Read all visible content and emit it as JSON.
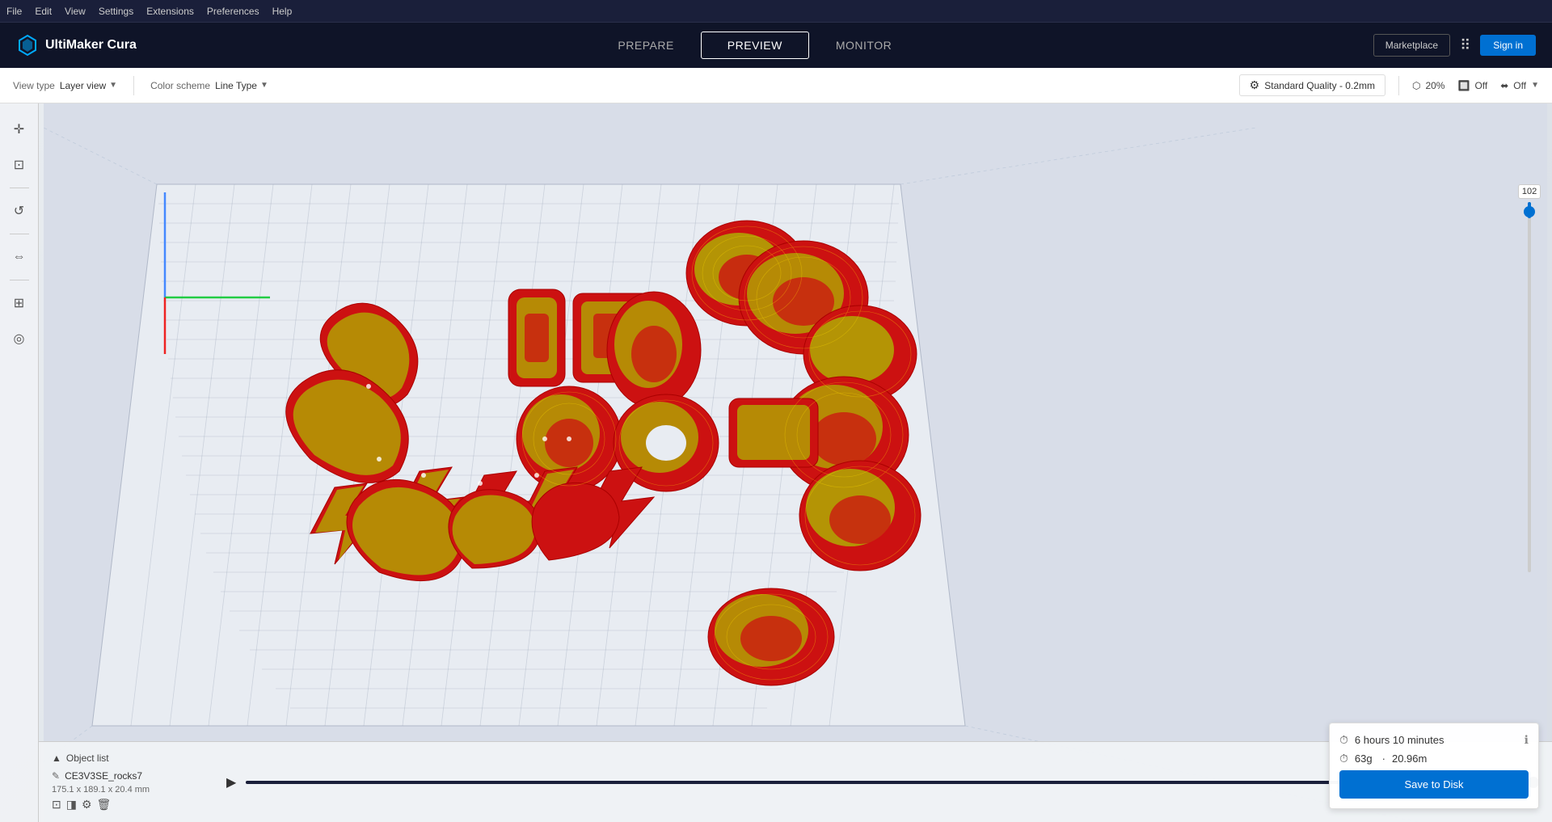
{
  "app": {
    "title": "UltiMaker Cura",
    "logo_symbol": "⬡"
  },
  "menu": {
    "items": [
      "File",
      "Edit",
      "View",
      "Settings",
      "Extensions",
      "Preferences",
      "Help"
    ]
  },
  "nav": {
    "tabs": [
      "PREPARE",
      "PREVIEW",
      "MONITOR"
    ],
    "active": "PREVIEW"
  },
  "header_right": {
    "marketplace": "Marketplace",
    "signin": "Sign in"
  },
  "toolbar": {
    "view_type_label": "View type",
    "view_type_value": "Layer view",
    "color_scheme_label": "Color scheme",
    "color_scheme_value": "Line Type",
    "quality_label": "Standard Quality - 0.2mm",
    "infill_label": "20%",
    "support_label": "Off",
    "adhesion_label": "Off"
  },
  "layer_slider": {
    "value": "102"
  },
  "object_list": {
    "header": "Object list",
    "items": [
      {
        "name": "CE3V3SE_rocks7",
        "dimensions": "175.1 x 189.1 x 20.4 mm"
      }
    ]
  },
  "print_info": {
    "time": "6 hours 10 minutes",
    "weight": "63g",
    "length": "20.96m",
    "save_label": "Save to Disk"
  },
  "playback": {
    "play_icon": "▶"
  },
  "left_tools": [
    {
      "name": "move",
      "icon": "+"
    },
    {
      "name": "scale",
      "icon": "⊡"
    },
    {
      "name": "undo",
      "icon": "↺"
    },
    {
      "name": "mirror",
      "icon": "⇔"
    },
    {
      "name": "arrange",
      "icon": "⊞"
    },
    {
      "name": "support",
      "icon": "◎"
    }
  ]
}
